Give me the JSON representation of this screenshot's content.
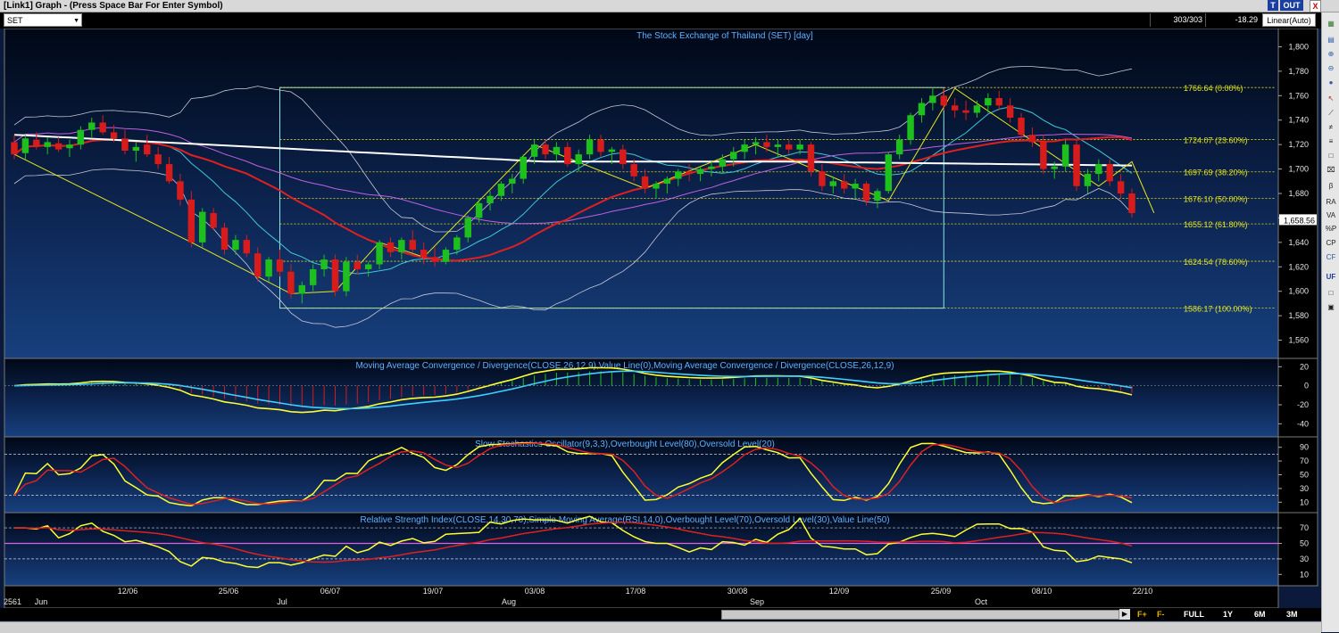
{
  "window": {
    "title": "[Link1] Graph - (Press Space Bar For Enter Symbol)",
    "btn_t": "T",
    "btn_out": "OUT",
    "btn_close": "X"
  },
  "toolbar": {
    "symbol": "SET",
    "count": "303/303",
    "change": "-18.29",
    "scale": "Linear(Auto)"
  },
  "sidebar": {
    "icons": [
      "RA",
      "VA",
      "%P",
      "CP",
      "CF",
      "UF"
    ]
  },
  "nav": {
    "f_plus": "F+",
    "f_minus": "F-",
    "ranges": [
      "FULL",
      "1Y",
      "6M",
      "3M"
    ]
  },
  "colors": {
    "background": "#0b1a3a",
    "up": "#1ec01e",
    "down": "#d81c1c",
    "fib": "#e6e61e",
    "box": "#8fe6e6"
  },
  "chart_data": [
    {
      "type": "candlestick",
      "title": "The Stock Exchange of Thailand (SET) [day]",
      "y_ticks": [
        "1,800",
        "1,780",
        "1,760",
        "1,740",
        "1,720",
        "1,700",
        "1,680",
        "1,660",
        "1,640",
        "1,620",
        "1,600",
        "1,580",
        "1,560"
      ],
      "ylim": [
        1548,
        1812
      ],
      "last_price": "1,658.56",
      "fib_levels": [
        {
          "value": 1766.64,
          "label": "1766.64 (0.00%)"
        },
        {
          "value": 1724.07,
          "label": "1724.07 (23.60%)"
        },
        {
          "value": 1697.69,
          "label": "1697.69 (38.20%)"
        },
        {
          "value": 1676.1,
          "label": "1676.10 (50.00%)"
        },
        {
          "value": 1655.12,
          "label": "1655.12 (61.80%)"
        },
        {
          "value": 1624.54,
          "label": "1624.54 (78.60%)"
        },
        {
          "value": 1586.17,
          "label": "1586.17 (100.00%)"
        }
      ],
      "ohlc": [
        [
          1722,
          1728,
          1708,
          1712
        ],
        [
          1713,
          1728,
          1708,
          1725
        ],
        [
          1724,
          1730,
          1716,
          1719
        ],
        [
          1718,
          1726,
          1712,
          1722
        ],
        [
          1721,
          1726,
          1714,
          1716
        ],
        [
          1717,
          1724,
          1710,
          1720
        ],
        [
          1720,
          1735,
          1716,
          1732
        ],
        [
          1732,
          1742,
          1726,
          1738
        ],
        [
          1738,
          1744,
          1728,
          1730
        ],
        [
          1730,
          1736,
          1722,
          1725
        ],
        [
          1725,
          1732,
          1712,
          1715
        ],
        [
          1715,
          1722,
          1706,
          1718
        ],
        [
          1720,
          1728,
          1710,
          1712
        ],
        [
          1712,
          1718,
          1700,
          1704
        ],
        [
          1704,
          1710,
          1688,
          1690
        ],
        [
          1690,
          1696,
          1670,
          1675
        ],
        [
          1675,
          1682,
          1636,
          1640
        ],
        [
          1640,
          1668,
          1636,
          1665
        ],
        [
          1664,
          1668,
          1650,
          1652
        ],
        [
          1652,
          1656,
          1630,
          1634
        ],
        [
          1634,
          1646,
          1630,
          1642
        ],
        [
          1642,
          1646,
          1628,
          1631
        ],
        [
          1631,
          1636,
          1608,
          1612
        ],
        [
          1612,
          1628,
          1608,
          1626
        ],
        [
          1626,
          1634,
          1612,
          1616
        ],
        [
          1616,
          1622,
          1594,
          1598
        ],
        [
          1598,
          1608,
          1590,
          1605
        ],
        [
          1605,
          1622,
          1600,
          1618
        ],
        [
          1618,
          1630,
          1612,
          1626
        ],
        [
          1626,
          1630,
          1596,
          1600
        ],
        [
          1600,
          1628,
          1596,
          1624
        ],
        [
          1624,
          1630,
          1614,
          1618
        ],
        [
          1618,
          1624,
          1612,
          1622
        ],
        [
          1622,
          1642,
          1618,
          1640
        ],
        [
          1640,
          1644,
          1628,
          1632
        ],
        [
          1632,
          1644,
          1626,
          1642
        ],
        [
          1642,
          1650,
          1632,
          1634
        ],
        [
          1634,
          1640,
          1622,
          1628
        ],
        [
          1628,
          1636,
          1620,
          1624
        ],
        [
          1624,
          1636,
          1622,
          1634
        ],
        [
          1634,
          1646,
          1630,
          1644
        ],
        [
          1644,
          1662,
          1640,
          1660
        ],
        [
          1660,
          1676,
          1656,
          1672
        ],
        [
          1672,
          1682,
          1666,
          1678
        ],
        [
          1678,
          1690,
          1674,
          1688
        ],
        [
          1688,
          1696,
          1680,
          1692
        ],
        [
          1692,
          1712,
          1688,
          1710
        ],
        [
          1710,
          1724,
          1704,
          1720
        ],
        [
          1720,
          1724,
          1708,
          1712
        ],
        [
          1712,
          1722,
          1706,
          1718
        ],
        [
          1718,
          1722,
          1702,
          1704
        ],
        [
          1704,
          1716,
          1698,
          1712
        ],
        [
          1712,
          1728,
          1708,
          1724
        ],
        [
          1724,
          1728,
          1710,
          1714
        ],
        [
          1714,
          1718,
          1704,
          1716
        ],
        [
          1716,
          1720,
          1700,
          1704
        ],
        [
          1704,
          1708,
          1690,
          1694
        ],
        [
          1694,
          1700,
          1680,
          1684
        ],
        [
          1684,
          1690,
          1676,
          1688
        ],
        [
          1688,
          1694,
          1680,
          1692
        ],
        [
          1692,
          1700,
          1686,
          1698
        ],
        [
          1698,
          1704,
          1690,
          1696
        ],
        [
          1696,
          1702,
          1690,
          1700
        ],
        [
          1700,
          1706,
          1694,
          1702
        ],
        [
          1702,
          1712,
          1696,
          1708
        ],
        [
          1708,
          1718,
          1702,
          1714
        ],
        [
          1714,
          1724,
          1708,
          1720
        ],
        [
          1720,
          1726,
          1712,
          1722
        ],
        [
          1722,
          1728,
          1714,
          1718
        ],
        [
          1718,
          1724,
          1710,
          1720
        ],
        [
          1720,
          1724,
          1712,
          1716
        ],
        [
          1716,
          1724,
          1712,
          1720
        ],
        [
          1720,
          1722,
          1694,
          1698
        ],
        [
          1698,
          1704,
          1682,
          1686
        ],
        [
          1686,
          1694,
          1680,
          1690
        ],
        [
          1690,
          1696,
          1680,
          1684
        ],
        [
          1684,
          1692,
          1676,
          1688
        ],
        [
          1688,
          1690,
          1670,
          1674
        ],
        [
          1674,
          1684,
          1668,
          1682
        ],
        [
          1682,
          1714,
          1680,
          1712
        ],
        [
          1712,
          1728,
          1708,
          1724
        ],
        [
          1724,
          1746,
          1720,
          1744
        ],
        [
          1744,
          1758,
          1738,
          1754
        ],
        [
          1754,
          1766,
          1748,
          1760
        ],
        [
          1760,
          1766,
          1748,
          1752
        ],
        [
          1752,
          1758,
          1742,
          1748
        ],
        [
          1748,
          1756,
          1740,
          1746
        ],
        [
          1746,
          1756,
          1742,
          1752
        ],
        [
          1752,
          1762,
          1746,
          1758
        ],
        [
          1758,
          1764,
          1748,
          1752
        ],
        [
          1752,
          1758,
          1738,
          1742
        ],
        [
          1742,
          1746,
          1724,
          1728
        ],
        [
          1728,
          1734,
          1718,
          1722
        ],
        [
          1722,
          1728,
          1696,
          1700
        ],
        [
          1700,
          1706,
          1692,
          1702
        ],
        [
          1702,
          1724,
          1698,
          1720
        ],
        [
          1720,
          1724,
          1682,
          1686
        ],
        [
          1686,
          1700,
          1680,
          1696
        ],
        [
          1696,
          1708,
          1690,
          1704
        ],
        [
          1704,
          1708,
          1686,
          1690
        ],
        [
          1690,
          1696,
          1676,
          1680
        ],
        [
          1680,
          1684,
          1660,
          1664
        ]
      ]
    },
    {
      "type": "line",
      "title": "Moving Average Convergence / Divergence(CLOSE,26,12,9),Value Line(0),Moving Average Convergence / Divergence(CLOSE,26,12,9)",
      "y_ticks": [
        "20",
        "0",
        "-20",
        "-40"
      ],
      "ylim": [
        -50,
        25
      ]
    },
    {
      "type": "line",
      "title": "Slow Stochastics Oscillator(9,3,3),Overbought Level(80),Oversold Level(20)",
      "y_ticks": [
        "90",
        "70",
        "50",
        "30",
        "10"
      ],
      "ylim": [
        0,
        100
      ],
      "levels": [
        80,
        20
      ]
    },
    {
      "type": "line",
      "title": "Relative Strength Index(CLOSE,14,30,70),Simple Moving Average(RSI,14,0),Overbought Level(70),Oversold Level(30),Value Line(50)",
      "y_ticks": [
        "70",
        "50",
        "30",
        "10"
      ],
      "ylim": [
        0,
        85
      ],
      "levels": [
        70,
        50,
        30
      ]
    }
  ],
  "x_axis": {
    "labels": [
      "2561",
      "Jun",
      "12/06",
      "25/06",
      "Jul",
      "06/07",
      "19/07",
      "Aug",
      "03/08",
      "17/08",
      "30/08",
      "Sep",
      "12/09",
      "25/09",
      "Oct",
      "08/10",
      "22/10"
    ]
  }
}
